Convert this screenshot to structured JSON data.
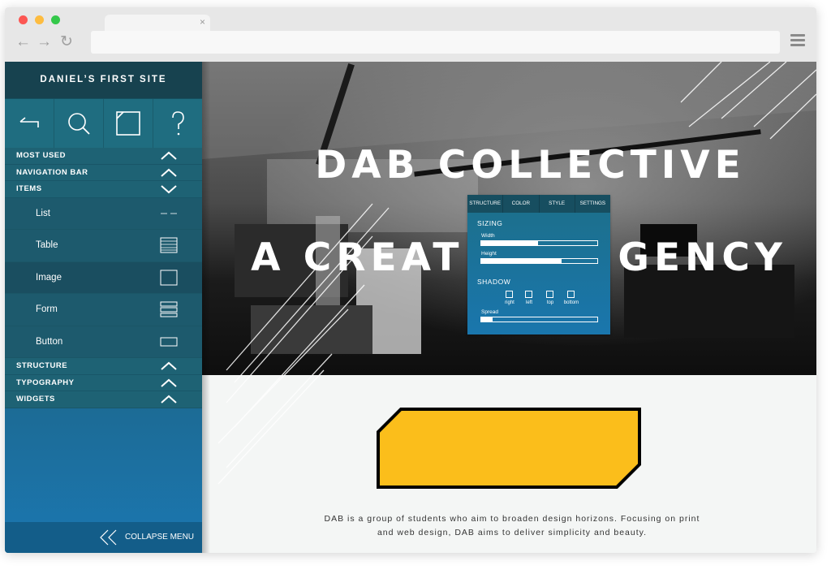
{
  "browser": {
    "tab_close": "×",
    "back": "←",
    "forward": "→",
    "reload": "↻"
  },
  "sidebar": {
    "site_title": "DANIEL’S FIRST SITE",
    "tools": [
      "back-tool-icon",
      "search-icon",
      "crop-icon",
      "help-icon"
    ],
    "sections_top": [
      {
        "label": "MOST USED",
        "state": "collapsed"
      },
      {
        "label": "NAVIGATION BAR",
        "state": "collapsed"
      },
      {
        "label": "ITEMS",
        "state": "expanded"
      }
    ],
    "items": [
      {
        "label": "List",
        "icon": "list-icon"
      },
      {
        "label": "Table",
        "icon": "table-icon"
      },
      {
        "label": "Image",
        "icon": "image-icon"
      },
      {
        "label": "Form",
        "icon": "form-icon"
      },
      {
        "label": "Button",
        "icon": "button-icon"
      }
    ],
    "sections_bottom": [
      {
        "label": "STRUCTURE"
      },
      {
        "label": "TYPOGRAPHY"
      },
      {
        "label": "WIDGETS"
      }
    ],
    "collapse_label": "COLLAPSE MENU"
  },
  "hero": {
    "title_line1": "DAB COLLECTIVE",
    "title_line2": "A CREAT",
    "title_line2_end": "GENCY"
  },
  "properties_panel": {
    "tabs": [
      "STRUCTURE",
      "COLOR",
      "STYLE",
      "SETTINGS"
    ],
    "sizing_label": "SIZING",
    "width_label": "Width",
    "width_value": 0.49,
    "height_label": "Height",
    "height_value": 0.69,
    "shadow_label": "SHADOW",
    "shadow_options": [
      "right",
      "left",
      "top",
      "bottom"
    ],
    "spread_label": "Spread",
    "spread_value": 0.1
  },
  "content": {
    "description_line1": "DAB is a group of students who aim to broaden design horizons. Focusing on print",
    "description_line2": "and web design, DAB aims to deliver simplicity and beauty.",
    "accent_color": "#fbbe1b"
  }
}
